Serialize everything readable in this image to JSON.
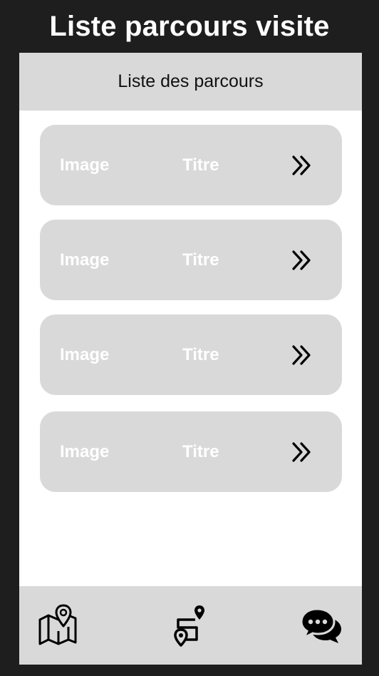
{
  "frame_title": "Liste parcours visite",
  "header": {
    "title": "Liste des parcours"
  },
  "cards": [
    {
      "image_label": "Image",
      "title_label": "Titre",
      "icon": "double-chevron-right-icon"
    },
    {
      "image_label": "Image",
      "title_label": "Titre",
      "icon": "double-chevron-right-icon"
    },
    {
      "image_label": "Image",
      "title_label": "Titre",
      "icon": "double-chevron-right-icon"
    },
    {
      "image_label": "Image",
      "title_label": "Titre",
      "icon": "double-chevron-right-icon"
    }
  ],
  "bottom_nav": {
    "items": [
      {
        "icon": "map-icon"
      },
      {
        "icon": "route-icon"
      },
      {
        "icon": "chat-icon"
      }
    ]
  },
  "colors": {
    "frame_background": "#1e1e1e",
    "panel_gray": "#d9d9d9",
    "screen_background": "#ffffff",
    "label_white": "#ffffff",
    "icon_black": "#000000"
  }
}
